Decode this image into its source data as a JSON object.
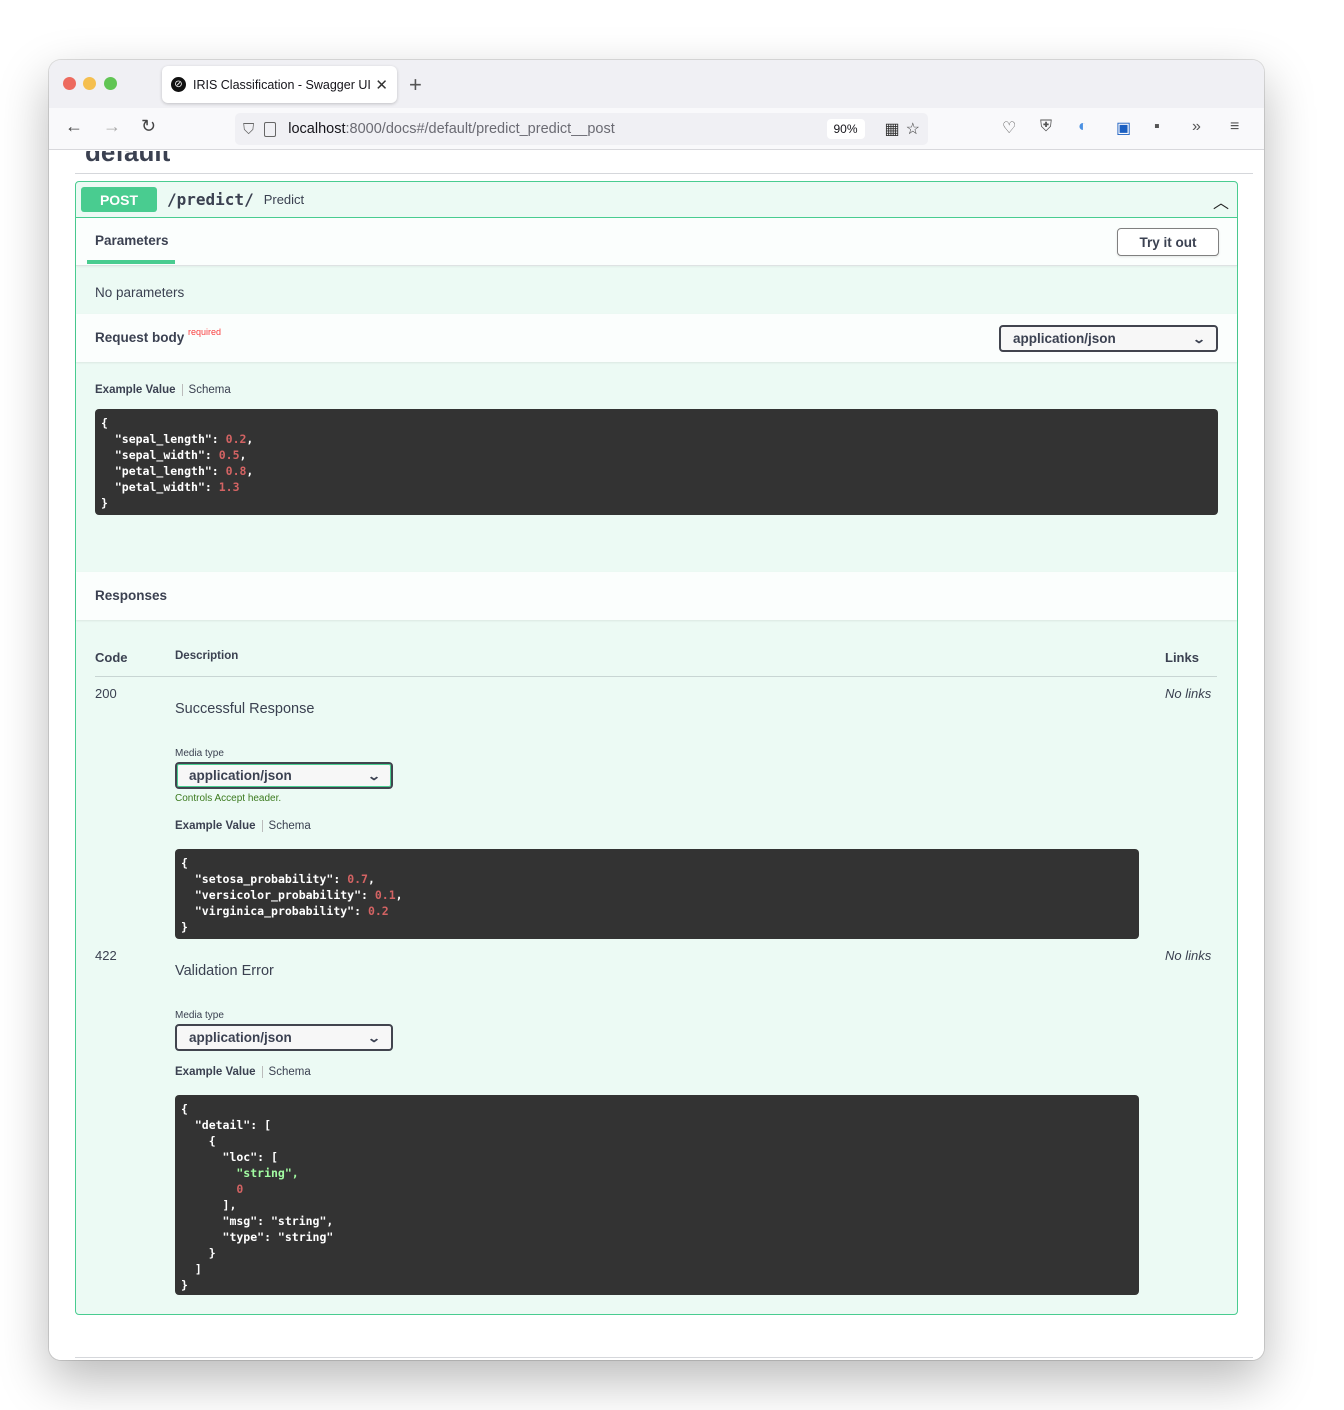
{
  "browser": {
    "tab_title": "IRIS Classification - Swagger UI",
    "tab_close": "✕",
    "new_tab": "+",
    "url_host": "localhost",
    "url_path": ":8000/docs#/default/predict_predict__post",
    "zoom": "90%"
  },
  "page": {
    "section_title": "default"
  },
  "operation": {
    "method": "POST",
    "path": "/predict/",
    "summary": "Predict",
    "parameters_tab": "Parameters",
    "try_button": "Try it out",
    "no_parameters": "No parameters",
    "request_body_title": "Request body",
    "required_label": "required",
    "request_media_type": "application/json",
    "example_value_tab": "Example Value",
    "schema_tab": "Schema",
    "request_example": {
      "open": "{",
      "fields": [
        {
          "key": "\"sepal_length\": ",
          "value": "0.2",
          "trail": ","
        },
        {
          "key": "\"sepal_width\": ",
          "value": "0.5",
          "trail": ","
        },
        {
          "key": "\"petal_length\": ",
          "value": "0.8",
          "trail": ","
        },
        {
          "key": "\"petal_width\": ",
          "value": "1.3",
          "trail": ""
        }
      ],
      "close": "}"
    }
  },
  "responses": {
    "title": "Responses",
    "col_code": "Code",
    "col_description": "Description",
    "col_links": "Links",
    "media_type_label": "Media type",
    "controls_accept": "Controls Accept header.",
    "items": [
      {
        "code": "200",
        "description": "Successful Response",
        "links": "No links",
        "media_type": "application/json",
        "example": {
          "open": "{",
          "fields": [
            {
              "key": "\"setosa_probability\": ",
              "value": "0.7",
              "trail": ","
            },
            {
              "key": "\"versicolor_probability\": ",
              "value": "0.1",
              "trail": ","
            },
            {
              "key": "\"virginica_probability\": ",
              "value": "0.2",
              "trail": ""
            }
          ],
          "close": "}"
        }
      },
      {
        "code": "422",
        "description": "Validation Error",
        "links": "No links",
        "media_type": "application/json",
        "example_lines": [
          "{",
          "  \"detail\": [",
          "    {",
          "      \"loc\": [",
          "        \"string\",",
          "        0",
          "      ],",
          "      \"msg\": \"string\",",
          "      \"type\": \"string\"",
          "    }",
          "  ]",
          "}"
        ]
      }
    ]
  },
  "colors": {
    "post_green": "#49cc90",
    "code_bg": "#333333",
    "number": "#d36363",
    "string": "#a2fca2"
  }
}
